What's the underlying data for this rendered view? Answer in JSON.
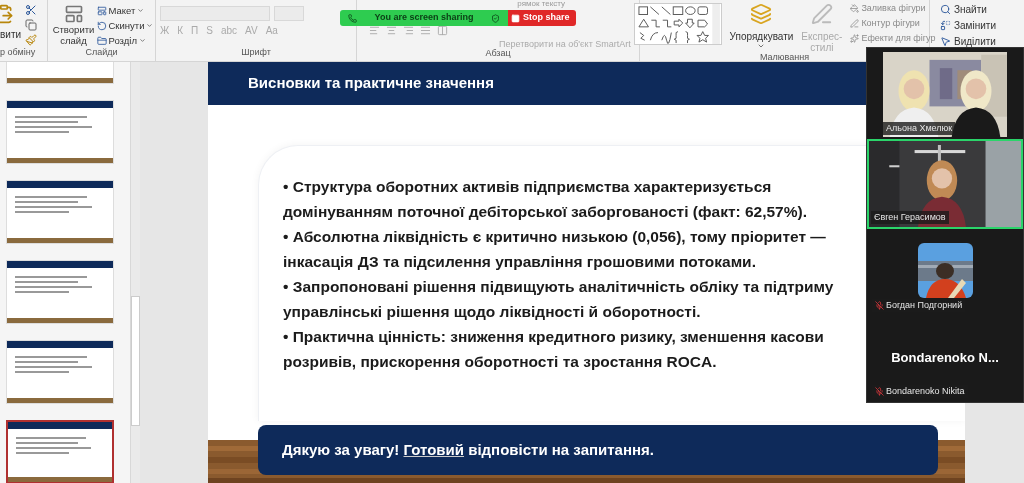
{
  "ribbon": {
    "clipboard": {
      "paste": "вити",
      "label": "р обміну"
    },
    "slides": {
      "new_slide": "Створити слайд",
      "items": [
        "Макет",
        "Скинути",
        "Розділ"
      ],
      "label": "Слайди"
    },
    "font": {
      "format_buttons": [
        "Ж",
        "К",
        "П",
        "S",
        "abc",
        "AV",
        "Aa"
      ],
      "label": "Шрифт"
    },
    "paragraph": {
      "text_direction": "рямок тексту",
      "smartart": "Перетворити на об'єкт SmartArt",
      "label": "Абзац"
    },
    "drawing": {
      "arrange": "Упорядкувати",
      "styles": [
        "Експрес-",
        "стилі"
      ],
      "shape_options": [
        "Заливка фігури",
        "Контур фігури",
        "Ефекти для фігур"
      ],
      "label": "Малювання"
    },
    "editing": {
      "items": [
        "Знайти",
        "Замінити",
        "Виділити"
      ]
    }
  },
  "share_bar": {
    "status": "You are screen sharing",
    "stop": "Stop share"
  },
  "thumbnails": [
    {
      "selected": false
    },
    {
      "selected": false
    },
    {
      "selected": false
    },
    {
      "selected": false
    },
    {
      "selected": false
    },
    {
      "selected": true
    }
  ],
  "slide": {
    "title": "Висновки та практичне значення",
    "lines": [
      "• Структура оборотних активів підприємства характеризується",
      "домінуванням поточної дебіторської заборгованості (факт: 62,57%).",
      "• Абсолютна ліквідність є критично низькою (0,056), тому пріоритет —",
      "інкасація ДЗ та підсилення управління грошовими потоками.",
      "• Запропоновані рішення підвищують аналітичність обліку та підтриму",
      "управлінські рішення щодо ліквідності й оборотності.",
      "• Практична цінність: зниження кредитного ризику, зменшення касови",
      "розривів, прискорення оборотності та зростання ROCA."
    ],
    "footer": [
      {
        "text": "Дякую за увагу!",
        "flagged": false
      },
      {
        "text": "Готовий",
        "flagged": true
      },
      {
        "text": "відповісти на запитання.",
        "flagged": false
      }
    ]
  },
  "participants": [
    {
      "kind": "video",
      "name": "Альона Хмелюк",
      "speaking": false,
      "muted": false
    },
    {
      "kind": "video2",
      "name": "Євген Герасимов",
      "speaking": true,
      "muted": false
    },
    {
      "kind": "avatar",
      "name": "Богдан Подгорний",
      "speaking": false,
      "muted": true
    },
    {
      "kind": "name",
      "display": "Bondarenoko N...",
      "name": "Bondarenoko Nikita",
      "speaking": false,
      "muted": true
    }
  ]
}
